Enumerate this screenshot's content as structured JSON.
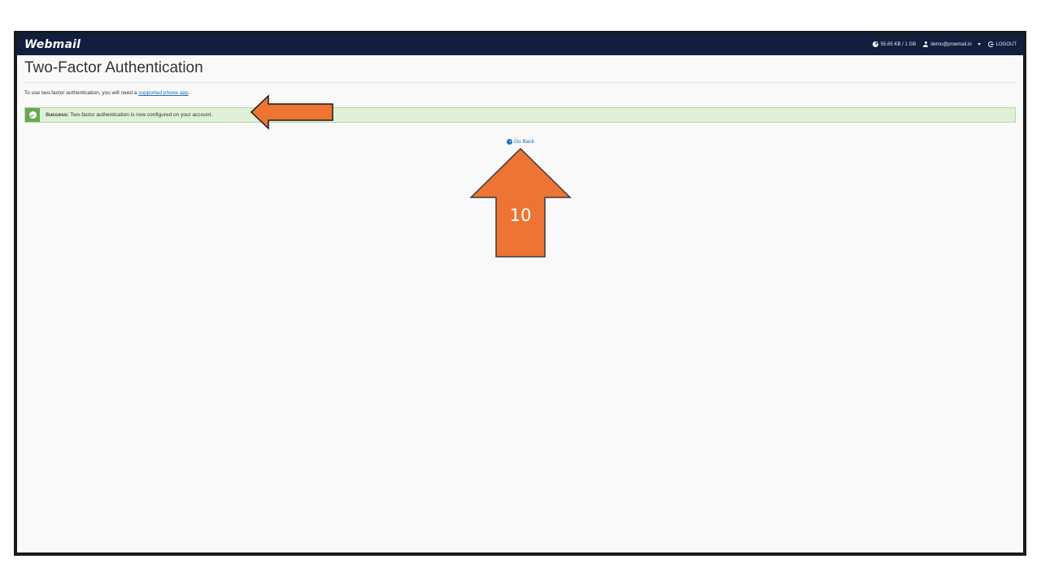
{
  "topbar": {
    "brand": "Webmail",
    "quota": "55.65 KB / 1 GB",
    "user": "demo@proemail.in",
    "logout": "LOGOUT"
  },
  "page": {
    "title": "Two-Factor Authentication",
    "intro_prefix": "To use two-factor authentication, you will need a ",
    "intro_link": "supported phone app",
    "intro_suffix": "."
  },
  "alert": {
    "label": "Success:",
    "message": " Two-factor authentication is now configured on your account.",
    "color": "#dff0d8"
  },
  "go_back": "Go Back",
  "annotations": {
    "step_number": "10",
    "arrow_color": "#ed7433"
  },
  "icons": {
    "quota": "pie-chart-icon",
    "user": "user-icon",
    "logout": "logout-icon",
    "alert": "check-circle-icon",
    "go_back": "arrow-circle-left-icon"
  }
}
